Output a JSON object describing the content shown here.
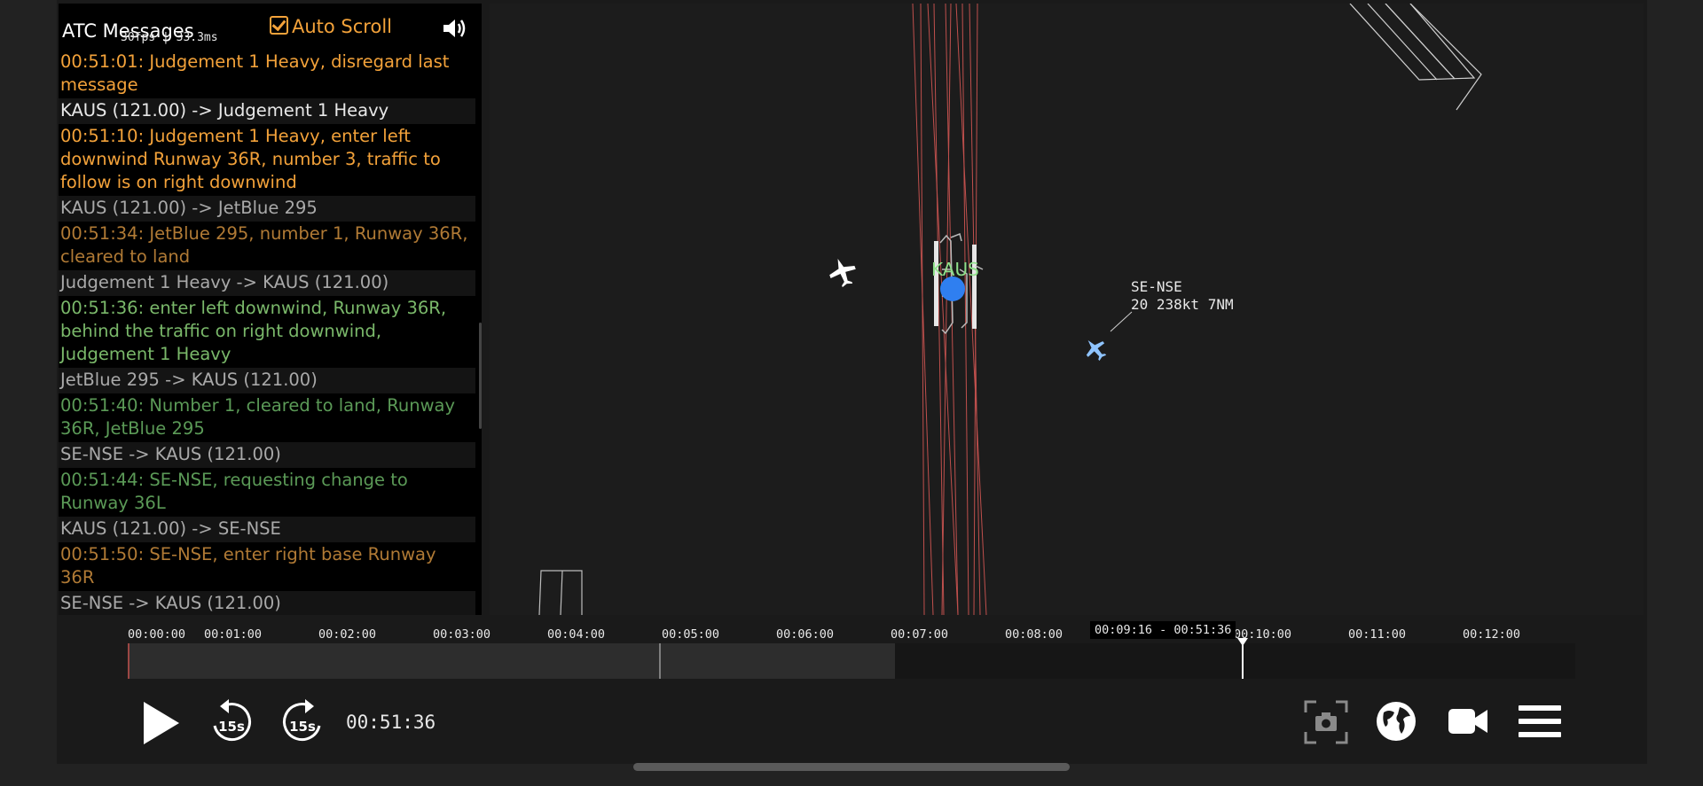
{
  "panel": {
    "title": "ATC Messages",
    "fps": "30fps | 33.3ms",
    "autoscroll_label": "Auto Scroll",
    "messages": [
      {
        "text": "00:51:01: Judgement 1 Heavy, disregard last message",
        "color": "orange"
      },
      {
        "text": "KAUS (121.00) -> Judgement 1 Heavy",
        "color": "white"
      },
      {
        "text": "00:51:10: Judgement 1 Heavy, enter left downwind Runway 36R, number 3, traffic to follow is on right downwind",
        "color": "orange"
      },
      {
        "text": "KAUS (121.00) -> JetBlue 295",
        "color": "gray"
      },
      {
        "text": "00:51:34: JetBlue 295, number 1, Runway 36R, cleared to land",
        "color": "dorange"
      },
      {
        "text": "Judgement 1 Heavy -> KAUS (121.00)",
        "color": "gray"
      },
      {
        "text": "00:51:36: enter left downwind, Runway 36R, behind the traffic on right downwind, Judgement 1 Heavy",
        "color": "green"
      },
      {
        "text": "JetBlue 295 -> KAUS (121.00)",
        "color": "gray"
      },
      {
        "text": "00:51:40: Number 1, cleared to land, Runway 36R, JetBlue 295",
        "color": "dgreen"
      },
      {
        "text": "SE-NSE -> KAUS (121.00)",
        "color": "gray"
      },
      {
        "text": "00:51:44: SE-NSE, requesting change to Runway 36L",
        "color": "dgreen"
      },
      {
        "text": "KAUS (121.00) -> SE-NSE",
        "color": "gray"
      },
      {
        "text": "00:51:50: SE-NSE, enter right base Runway 36R",
        "color": "dorange"
      },
      {
        "text": "SE-NSE -> KAUS (121.00)",
        "color": "gray"
      }
    ]
  },
  "map": {
    "airport_label": "KAUS",
    "aircraft": {
      "callsign": "SE-NSE",
      "info": "20 238kt 7NM"
    }
  },
  "timeline": {
    "ticks": [
      "00:00:00",
      "00:01:00",
      "00:02:00",
      "00:03:00",
      "00:04:00",
      "00:05:00",
      "00:06:00",
      "00:07:00",
      "00:08:00",
      "00:10:00",
      "00:11:00",
      "00:12:00"
    ],
    "tooltip": "00:09:16 - 00:51:36",
    "loaded_fraction": 0.53,
    "playhead_fraction": 0.77,
    "current_time": "00:51:36"
  },
  "controls": {
    "skip_back_label": "15s",
    "skip_forward_label": "15s"
  },
  "colors": {
    "accent_orange": "#f3a23a",
    "airport_green": "#8fe08a",
    "runway_line": "#c0504d",
    "marker_blue": "#2f7ff0"
  }
}
